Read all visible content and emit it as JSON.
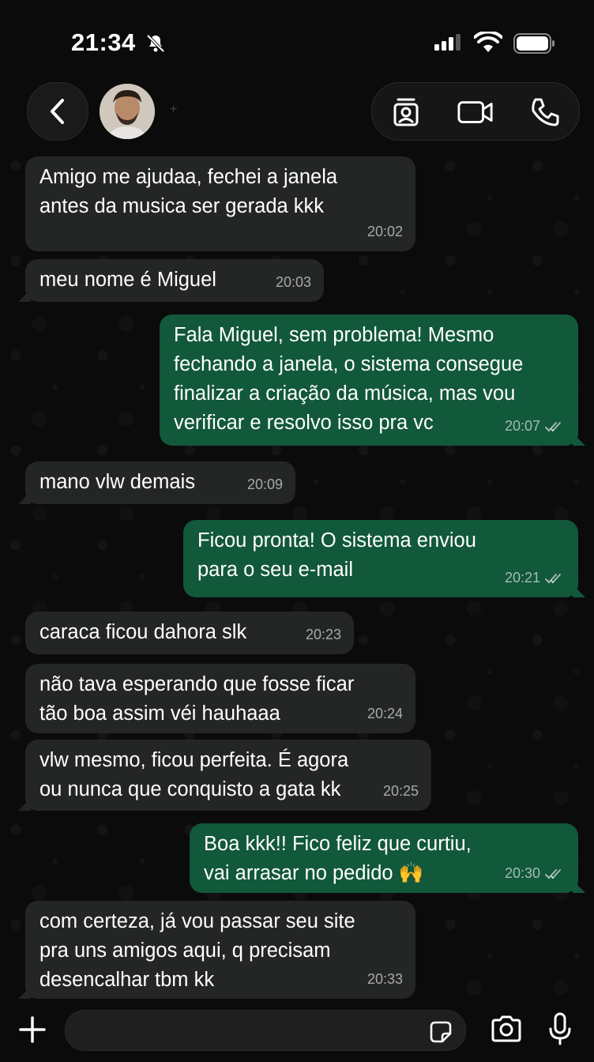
{
  "status_bar": {
    "time": "21:34"
  },
  "composer": {
    "placeholder": ""
  },
  "messages": [
    {
      "dir": "in",
      "text": "Amigo me ajudaa, fechei a janela\nantes da musica ser gerada kkk",
      "time": "20:02"
    },
    {
      "dir": "in",
      "text": "meu nome é Miguel",
      "time": "20:03"
    },
    {
      "dir": "out",
      "text": "Fala Miguel, sem problema! Mesmo\nfechando a janela, o sistema consegue\nfinalizar a criação da música, mas vou\nverificar e resolvo isso pra vc",
      "time": "20:07",
      "read": true
    },
    {
      "dir": "in",
      "text": "mano vlw demais",
      "time": "20:09"
    },
    {
      "dir": "out",
      "text": "Ficou pronta! O sistema enviou\npara o seu e-mail",
      "time": "20:21",
      "read": true
    },
    {
      "dir": "in",
      "text": "caraca ficou dahora slk",
      "time": "20:23"
    },
    {
      "dir": "in",
      "text": "não tava esperando que fosse ficar\ntão boa assim véi hauhaaa",
      "time": "20:24"
    },
    {
      "dir": "in",
      "text": "vlw mesmo, ficou perfeita. É agora\nou nunca que conquisto a gata kk",
      "time": "20:25"
    },
    {
      "dir": "out",
      "text": "Boa kkk!! Fico feliz que curtiu,\nvai arrasar no pedido 🙌",
      "time": "20:30",
      "read": true
    },
    {
      "dir": "in",
      "text": "com certeza, já vou passar seu site\npra uns amigos aqui, q precisam\ndesencalhar tbm kk",
      "time": "20:33"
    }
  ],
  "icons": {
    "back": "chevron-left-icon",
    "contact_card": "contact-card-icon",
    "video": "video-camera-icon",
    "phone": "phone-icon",
    "add": "plus-icon",
    "sticker": "sticker-icon",
    "camera": "camera-icon",
    "mic": "microphone-icon",
    "read": "double-check-icon",
    "mute": "bell-slash-icon"
  },
  "colors": {
    "incoming_bubble": "#242626",
    "outgoing_bubble": "#12583b",
    "background": "#0b0b0b"
  }
}
